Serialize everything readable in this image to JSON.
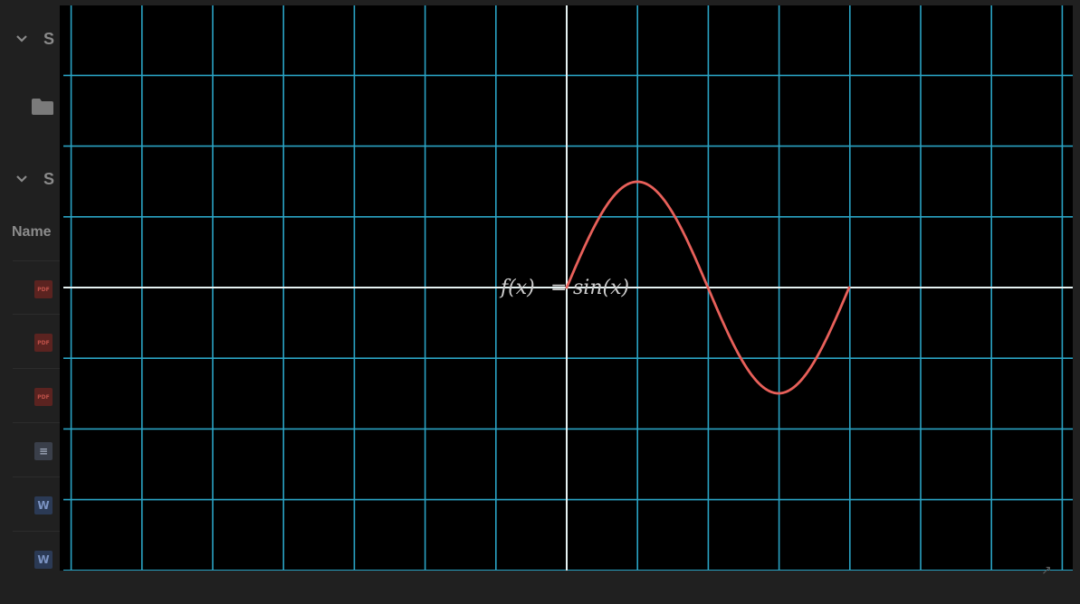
{
  "sidebar": {
    "sections": [
      {
        "label": "S"
      },
      {
        "label": "S"
      }
    ],
    "column_header": "Name",
    "files": [
      {
        "type": "pdf",
        "icon": "pdf-icon",
        "icon_text": "PDF"
      },
      {
        "type": "pdf",
        "icon": "pdf-icon",
        "icon_text": "PDF"
      },
      {
        "type": "pdf",
        "icon": "pdf-icon",
        "icon_text": "PDF"
      },
      {
        "type": "doc",
        "icon": "document-icon",
        "icon_text": "≡"
      },
      {
        "type": "word",
        "icon": "word-icon",
        "icon_text": "W"
      },
      {
        "type": "word",
        "icon": "word-icon",
        "icon_text": "W"
      }
    ]
  },
  "graph": {
    "formula_left": "f(x)",
    "formula_eq": "=",
    "formula_right": "sin(x)",
    "colors": {
      "background": "#000000",
      "grid": "#2aa3c4",
      "axis": "#e6f2f2",
      "curve": "#e8605a"
    }
  },
  "chart_data": {
    "type": "line",
    "title": "",
    "series": [
      {
        "name": "f(x) = sin(x)",
        "function": "sin",
        "x_start": 0,
        "x_end": 6.2832
      }
    ],
    "grid": true,
    "legend_placement": "none"
  }
}
